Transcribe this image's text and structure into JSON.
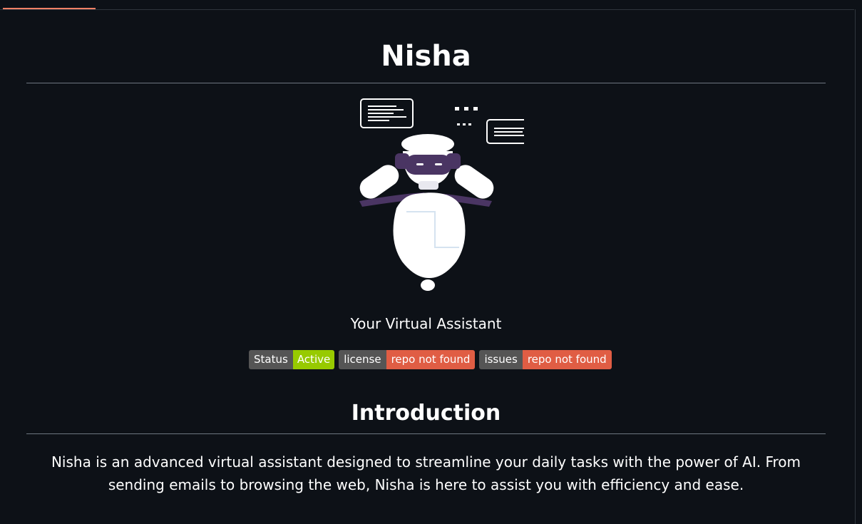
{
  "page": {
    "title": "Nisha",
    "subtitle": "Your Virtual Assistant"
  },
  "badges": [
    {
      "label": "Status",
      "value": "Active",
      "value_color": "#97ca00"
    },
    {
      "label": "license",
      "value": "repo not found",
      "value_color": "#e05d44"
    },
    {
      "label": "issues",
      "value": "repo not found",
      "value_color": "#e05d44"
    }
  ],
  "introduction": {
    "heading": "Introduction",
    "text": "Nisha is an advanced virtual assistant designed to streamline your daily tasks with the power of AI. From sending emails to browsing the web, Nisha is here to assist you with efficiency and ease."
  },
  "colors": {
    "background": "#0d1117",
    "accent_tab": "#f78166",
    "robot_visor": "#4a3563"
  },
  "hero_image": {
    "icon": "robot-assistant-icon"
  }
}
